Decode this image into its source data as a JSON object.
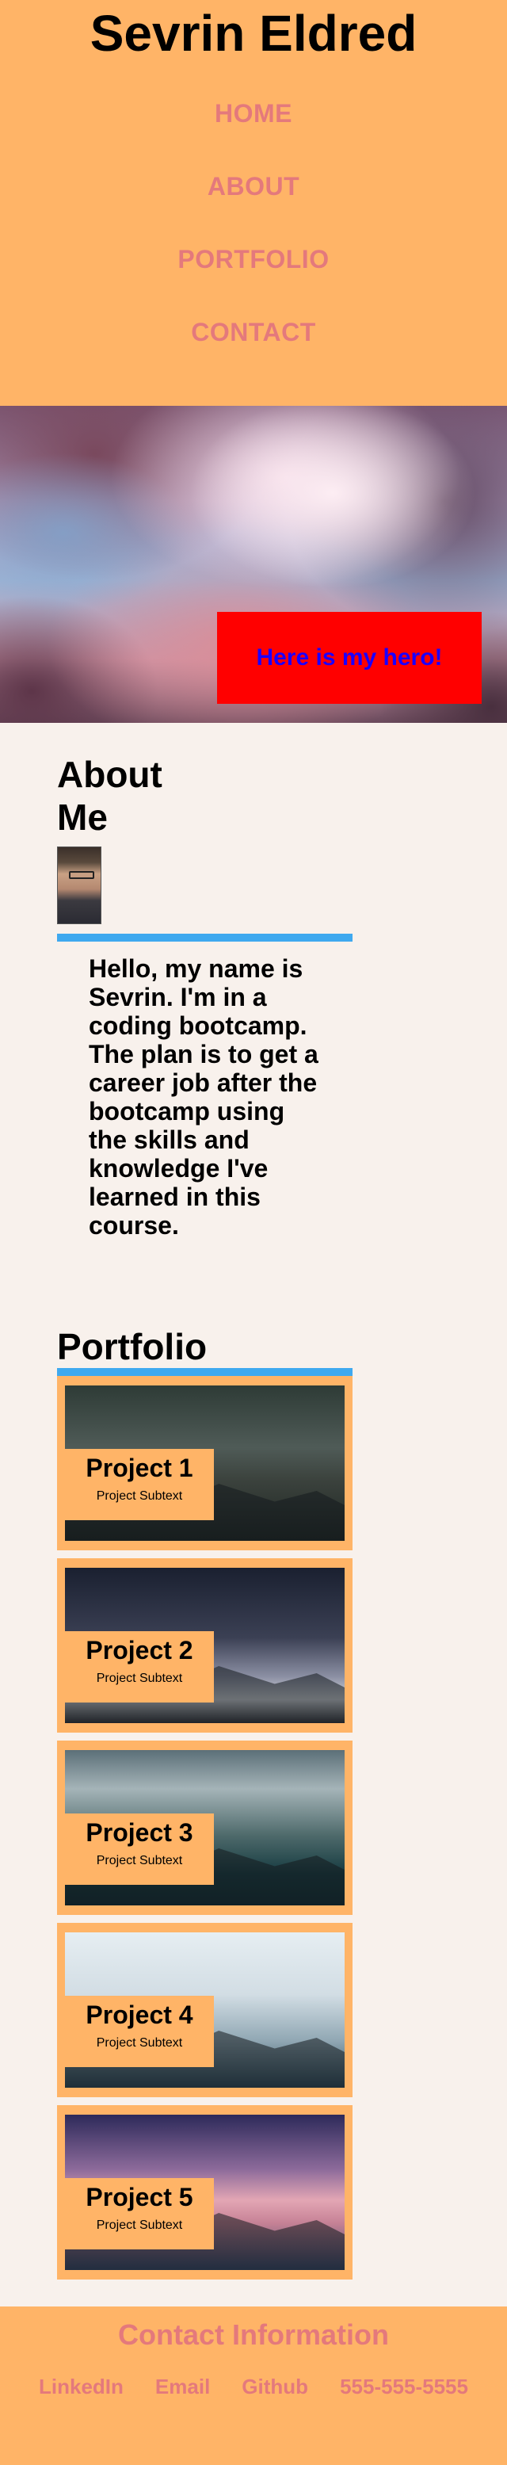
{
  "header": {
    "title": "Sevrin Eldred",
    "nav": [
      "HOME",
      "ABOUT",
      "PORTFOLIO",
      "CONTACT"
    ]
  },
  "hero": {
    "callout": "Here is my hero!"
  },
  "about": {
    "heading": "About Me",
    "text": "Hello, my name is Sevrin. I'm in a coding bootcamp. The plan is to get a career job after the bootcamp using the skills and knowledge I've learned in this course."
  },
  "portfolio": {
    "heading": "Portfolio",
    "projects": [
      {
        "title": "Project 1",
        "subtitle": "Project Subtext"
      },
      {
        "title": "Project 2",
        "subtitle": "Project Subtext"
      },
      {
        "title": "Project 3",
        "subtitle": "Project Subtext"
      },
      {
        "title": "Project 4",
        "subtitle": "Project Subtext"
      },
      {
        "title": "Project 5",
        "subtitle": "Project Subtext"
      }
    ]
  },
  "footer": {
    "title": "Contact Information",
    "links": [
      "LinkedIn",
      "Email",
      "Github",
      "555-555-5555"
    ]
  },
  "colors": {
    "header_bg": "#ffb467",
    "link": "#e4797c",
    "accent_rule": "#3fa9ef",
    "hero_callout_bg": "#ff0000",
    "hero_callout_text": "#1b00ff",
    "page_bg": "#f8f1ec"
  }
}
